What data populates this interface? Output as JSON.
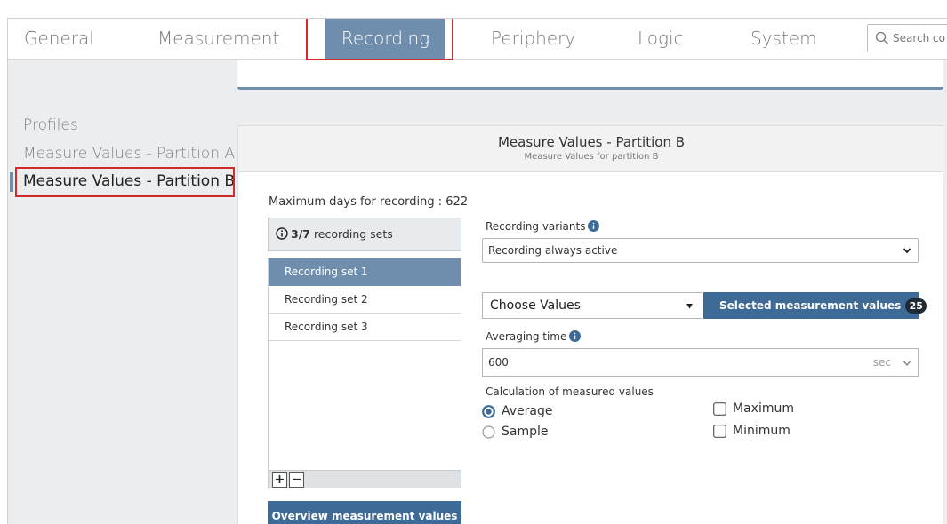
{
  "nav": {
    "tabs": [
      {
        "label": "General"
      },
      {
        "label": "Measurement"
      },
      {
        "label": "Recording"
      },
      {
        "label": "Periphery"
      },
      {
        "label": "Logic"
      },
      {
        "label": "System"
      }
    ],
    "active_tab": "Recording",
    "search_placeholder": "Search co"
  },
  "sidebar": {
    "heading": "Profiles",
    "items": [
      {
        "label": "Measure Values - Partition A"
      },
      {
        "label": "Measure Values - Partition B"
      }
    ],
    "active_item": "Measure Values - Partition B"
  },
  "panel": {
    "title": "Measure Values - Partition B",
    "subtitle": "Measure Values for partition B",
    "max_days_label": "Maximum days for recording : 622",
    "sets_current": "3",
    "sets_total": "/7",
    "sets_suffix": " recording sets",
    "recording_sets": [
      {
        "label": "Recording set 1"
      },
      {
        "label": "Recording set 2"
      },
      {
        "label": "Recording set 3"
      }
    ],
    "active_set": "Recording set 1",
    "add_symbol": "+",
    "remove_symbol": "−",
    "overview_button": "Overview measurement values",
    "recording_variants_label": "Recording variants",
    "recording_variant_value": "Recording always active",
    "choose_values_label": "Choose Values",
    "selected_values_button": "Selected measurement values",
    "selected_values_count": "25",
    "averaging_time_label": "Averaging time",
    "averaging_time_value": "600",
    "averaging_time_unit": "sec",
    "calculation_label": "Calculation of measured values",
    "radio_options": [
      {
        "label": "Average",
        "checked": true
      },
      {
        "label": "Sample",
        "checked": false
      }
    ],
    "checkbox_options": [
      {
        "label": "Maximum",
        "checked": false
      },
      {
        "label": "Minimum",
        "checked": false
      }
    ]
  },
  "colors": {
    "accent": "#6f8eae",
    "primary_button": "#3d6a96",
    "highlight": "#d12b2b",
    "background": "#ebedef"
  }
}
